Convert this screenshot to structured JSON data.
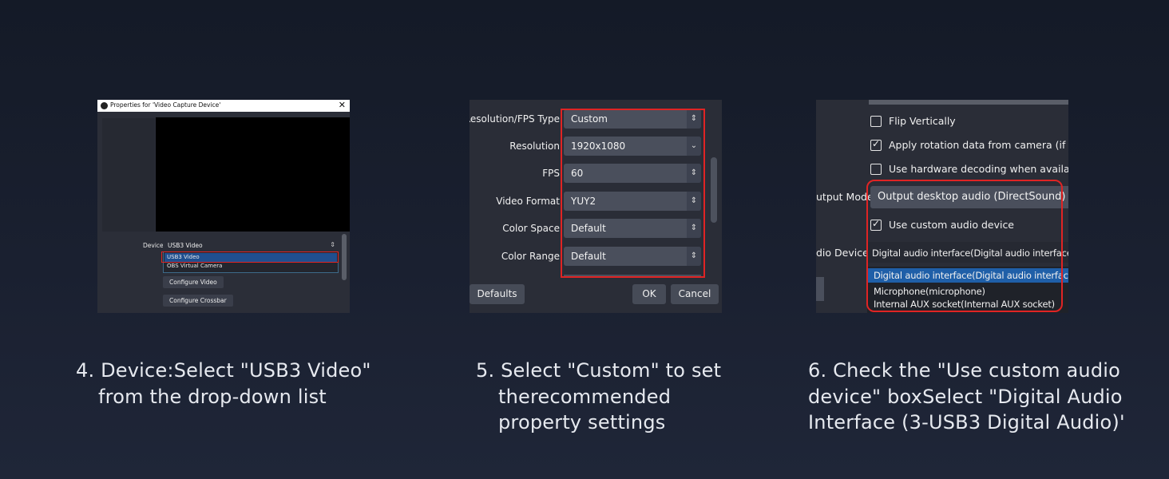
{
  "panel1": {
    "title": "Properties for 'Video Capture Device'",
    "close_glyph": "✕",
    "device_label": "Device",
    "device_value": "USB3 Video",
    "options": [
      "USB3 Video",
      "OBS Virtual Camera"
    ],
    "buttons": [
      "Configure Video",
      "Configure Crossbar"
    ]
  },
  "panel2": {
    "rows": [
      {
        "label": "Resolution/FPS Type",
        "value": "Custom"
      },
      {
        "label": "Resolution",
        "value": "1920x1080"
      },
      {
        "label": "FPS",
        "value": "60"
      },
      {
        "label": "Video Format",
        "value": "YUY2"
      },
      {
        "label": "Color Space",
        "value": "Default"
      },
      {
        "label": "Color Range",
        "value": "Default"
      }
    ],
    "defaults_label": "Defaults",
    "ok_label": "OK",
    "cancel_label": "Cancel"
  },
  "panel3": {
    "checkboxes": [
      {
        "label": "Flip Vertically",
        "checked": false
      },
      {
        "label": "Apply rotation data from camera (if an",
        "checked": true
      },
      {
        "label": "Use hardware decoding when available",
        "checked": false
      }
    ],
    "output_mode_label": "utput Mode",
    "output_mode_value": "Output desktop audio (DirectSound)",
    "custom_audio_label": "Use custom audio device",
    "audio_device_label": "dio Device",
    "audio_device_value": "Digital audio interface(Digital audio interface)",
    "audio_options": [
      "Digital audio interface(Digital audio interface)",
      "Microphone(microphone)",
      "Internal AUX socket(Internal AUX socket)"
    ]
  },
  "captions": {
    "c4": [
      "4. Device:Select \"USB3 Video\"",
      "from the drop-down list"
    ],
    "c5": [
      "5. Select \"Custom\" to set",
      "therecommended",
      "property settings"
    ],
    "c6": [
      "6. Check the \"Use custom audio",
      "device\" boxSelect \"Digital Audio",
      "Interface (3-USB3 Digital Audio)'"
    ]
  },
  "colors": {
    "highlight_red": "#e02424",
    "selection_blue": "#1f4f8f",
    "background": "#1a2030"
  }
}
